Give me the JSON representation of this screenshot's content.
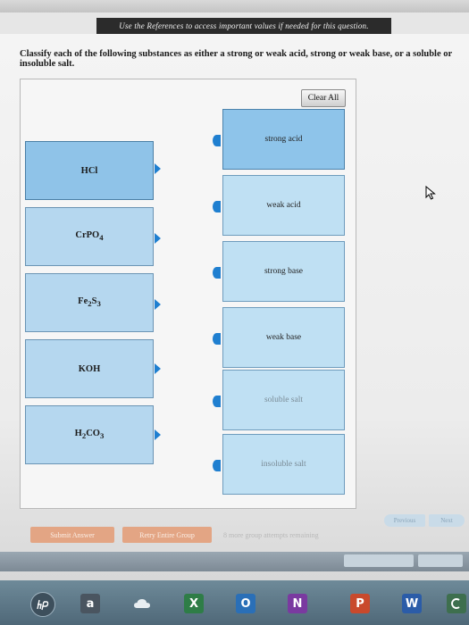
{
  "reference_bar": "Use the References to access important values if needed for this question.",
  "instructions": "Classify each of the following substances as either a strong or weak acid, strong or weak base, or a soluble or insoluble salt.",
  "clear_all_label": "Clear All",
  "substances": [
    "HCl",
    "CrPO4",
    "Fe2S3",
    "KOH",
    "H2CO3"
  ],
  "targets": [
    "strong acid",
    "weak acid",
    "strong base",
    "weak base",
    "soluble salt",
    "insoluble salt"
  ],
  "footer": {
    "submit_label": "Submit Answer",
    "retry_label": "Retry Entire Group",
    "attempts_text": "8 more group attempts remaining",
    "previous_label": "Previous",
    "next_label": "Next"
  },
  "taskbar": {
    "amazon_label": "a",
    "excel_label": "X",
    "outlook_label": "O",
    "onenote_label": "N",
    "powerpoint_label": "P",
    "word_label": "W"
  },
  "colors": {
    "source_box": "#b5d7ef",
    "target_box": "#bfe0f3",
    "handle": "#1f7fd0",
    "submit_button": "#e3a584"
  }
}
